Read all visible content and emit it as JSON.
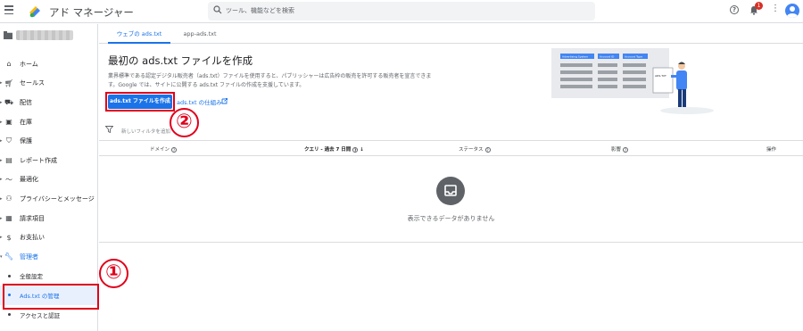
{
  "app": {
    "title": "アド マネージャー"
  },
  "search": {
    "placeholder": "ツール、機能などを検索"
  },
  "topbar": {
    "notification_count": "1"
  },
  "sidebar": {
    "items": [
      {
        "label": "ホーム",
        "icon": "home-icon"
      },
      {
        "label": "セールス",
        "icon": "cart-icon"
      },
      {
        "label": "配信",
        "icon": "truck-icon"
      },
      {
        "label": "在庫",
        "icon": "inventory-icon"
      },
      {
        "label": "保護",
        "icon": "shield-icon"
      },
      {
        "label": "レポート作成",
        "icon": "report-icon"
      },
      {
        "label": "最適化",
        "icon": "optimize-icon"
      },
      {
        "label": "プライバシーとメッセージ",
        "icon": "privacy-icon"
      },
      {
        "label": "請求項目",
        "icon": "billing-icon"
      },
      {
        "label": "お支払い",
        "icon": "payment-icon"
      },
      {
        "label": "管理者",
        "icon": "wrench-icon"
      }
    ],
    "subitems": [
      {
        "label": "全般設定"
      },
      {
        "label": "Ads.txt の管理"
      },
      {
        "label": "アクセスと認証"
      }
    ]
  },
  "tabs": [
    {
      "label": "ウェブの ads.txt"
    },
    {
      "label": "app-ads.txt"
    }
  ],
  "hero": {
    "title": "最初の ads.txt ファイルを作成",
    "desc_line1": "業界標準である認定デジタル販売者（ads.txt）ファイルを使用すると、パブリッシャーは広告枠の販売を許可する販売者を宣言できま",
    "desc_line2": "す。Google では、サイトに公開する ads.txt ファイルの作成を支援しています。",
    "create_button": "ads.txt ファイルを作成",
    "how_link": "ads.txt の仕組み",
    "illus_labels": [
      "Advertising System",
      "Account ID",
      "Account Type"
    ],
    "illus_file": "ADS.TXT"
  },
  "filter": {
    "placeholder": "新しいフィルタを追加"
  },
  "table": {
    "columns": [
      "ドメイン",
      "クエリ - 過去 7 日間",
      "ステータス",
      "影響",
      "操作"
    ],
    "empty_text": "表示できるデータがありません"
  },
  "annotations": {
    "one": "①",
    "two": "②"
  },
  "colors": {
    "accent": "#1a73e8",
    "annotation": "#e0001a"
  }
}
